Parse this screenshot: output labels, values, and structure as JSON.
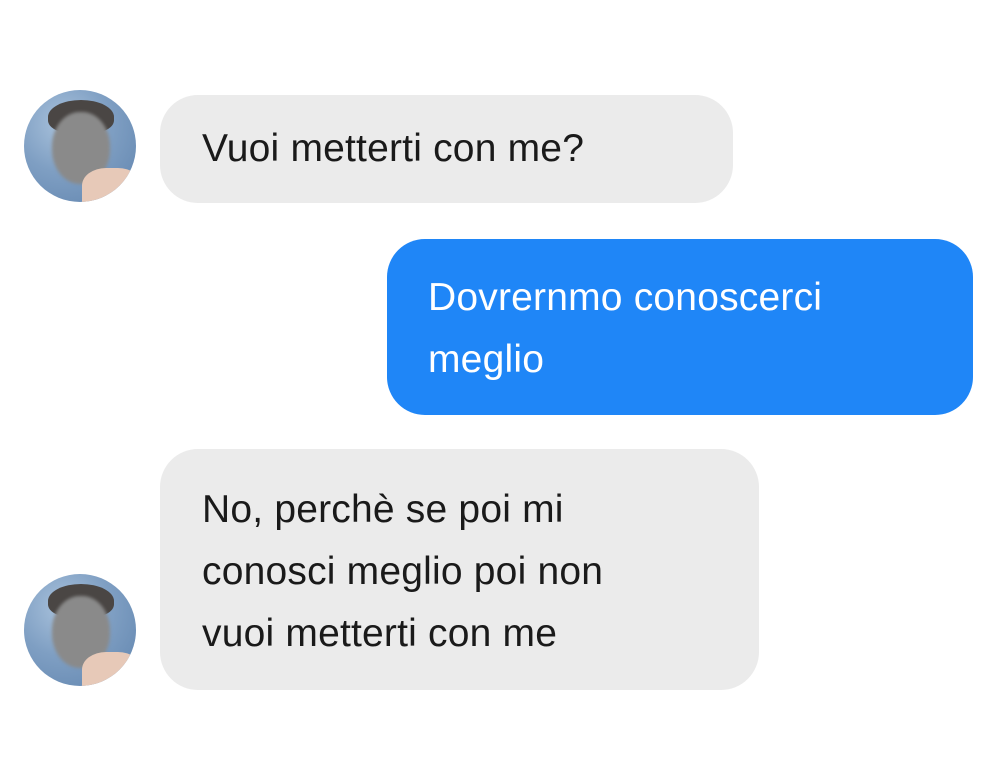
{
  "conversation": {
    "messages": [
      {
        "sender": "other",
        "lines": [
          "Vuoi metterti con me?"
        ]
      },
      {
        "sender": "me",
        "lines": [
          "Dovrernmo conoscerci",
          "meglio"
        ]
      },
      {
        "sender": "other",
        "lines": [
          "No, perchè se poi mi",
          "conosci meglio poi non",
          "vuoi metterti con me"
        ]
      }
    ]
  },
  "colors": {
    "sent_bubble": "#1f86f7",
    "received_bubble": "#ebebeb",
    "background": "#ffffff"
  }
}
